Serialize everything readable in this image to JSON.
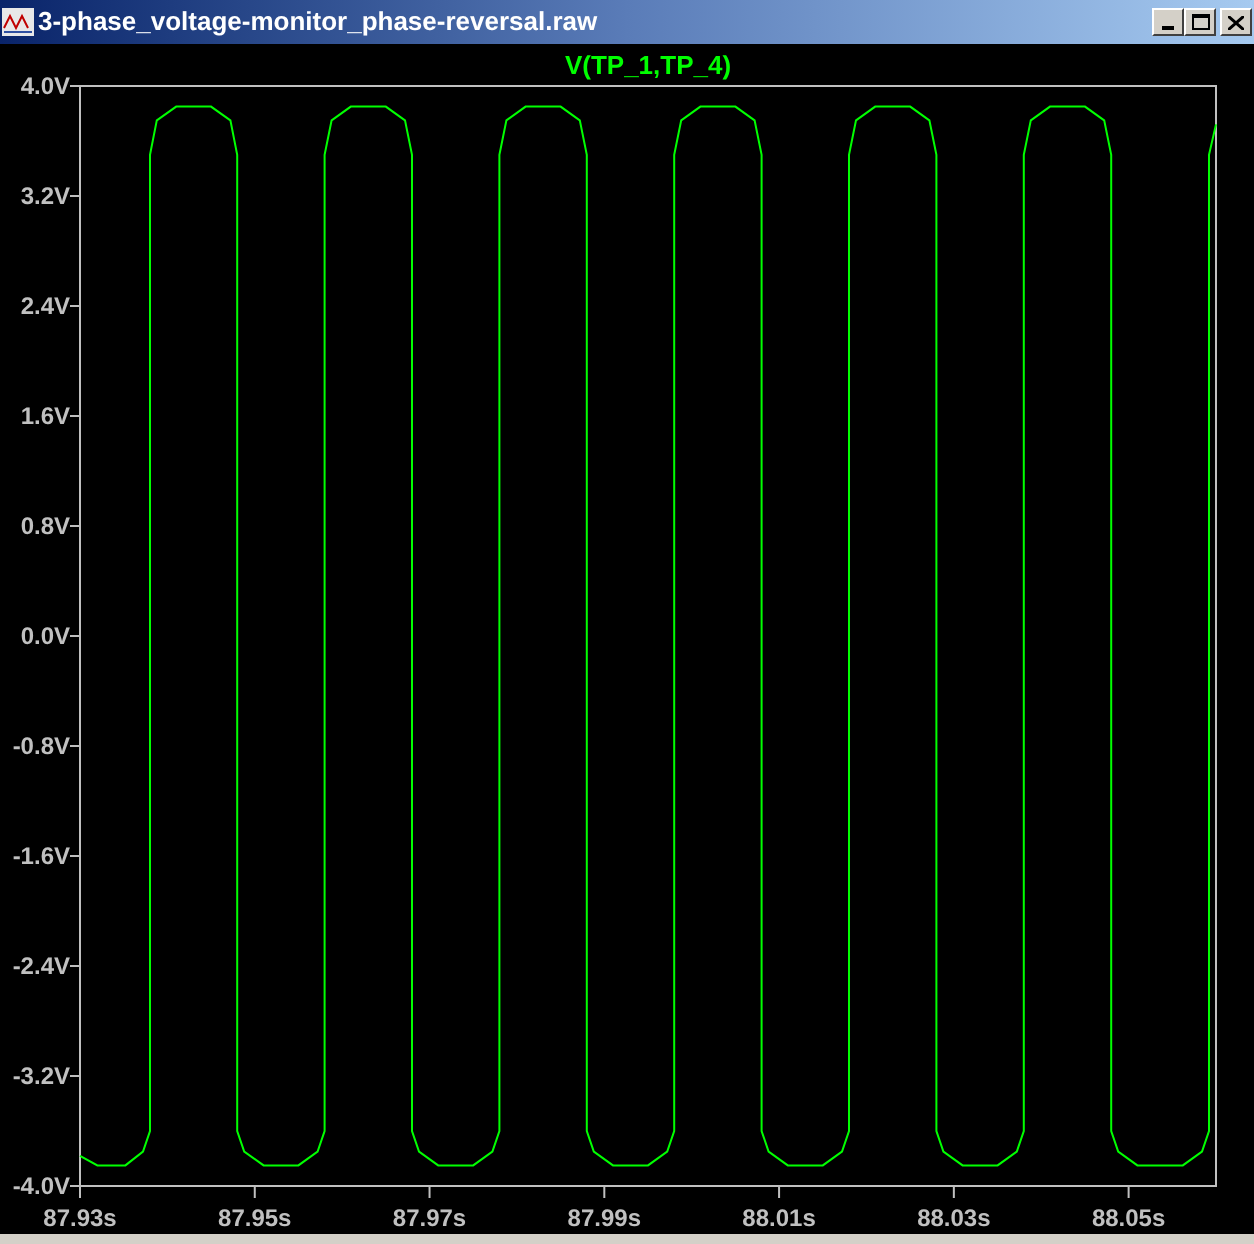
{
  "window": {
    "title": "3-phase_voltage-monitor_phase-reversal.raw"
  },
  "plot": {
    "chart_data": {
      "type": "line",
      "title": "V(TP_1,TP_4)",
      "xlim": [
        87.93,
        88.06
      ],
      "ylim": [
        -4,
        4
      ],
      "xticks": [
        {
          "value": 87.93,
          "label": "87.93s"
        },
        {
          "value": 87.95,
          "label": "87.95s"
        },
        {
          "value": 87.97,
          "label": "87.97s"
        },
        {
          "value": 87.99,
          "label": "87.99s"
        },
        {
          "value": 88.01,
          "label": "88.01s"
        },
        {
          "value": 88.03,
          "label": "88.03s"
        },
        {
          "value": 88.05,
          "label": "88.05s"
        }
      ],
      "yticks": [
        {
          "value": 4,
          "label": "4.0V"
        },
        {
          "value": 3.2,
          "label": "3.2V"
        },
        {
          "value": 2.4,
          "label": "2.4V"
        },
        {
          "value": 1.6,
          "label": "1.6V"
        },
        {
          "value": 0.8,
          "label": "0.8V"
        },
        {
          "value": 0,
          "label": "0.0V"
        },
        {
          "value": -0.8,
          "label": "-0.8V"
        },
        {
          "value": -1.6,
          "label": "-1.6V"
        },
        {
          "value": -2.4,
          "label": "-2.4V"
        },
        {
          "value": -3.2,
          "label": "-3.2V"
        },
        {
          "value": -4,
          "label": "-4.0V"
        }
      ],
      "x": [
        87.93,
        87.932,
        87.9352,
        87.9372,
        87.938,
        87.938,
        87.9388,
        87.941,
        87.945,
        87.9472,
        87.948,
        87.948,
        87.9488,
        87.951,
        87.955,
        87.9572,
        87.958,
        87.958,
        87.9588,
        87.961,
        87.965,
        87.9672,
        87.968,
        87.968,
        87.9688,
        87.971,
        87.975,
        87.9772,
        87.978,
        87.978,
        87.9788,
        87.981,
        87.985,
        87.9872,
        87.988,
        87.988,
        87.9888,
        87.991,
        87.995,
        87.9972,
        87.998,
        87.998,
        87.9988,
        88.001,
        88.005,
        88.0072,
        88.008,
        88.008,
        88.0088,
        88.011,
        88.015,
        88.0172,
        88.018,
        88.018,
        88.0188,
        88.021,
        88.025,
        88.0272,
        88.028,
        88.028,
        88.0288,
        88.031,
        88.035,
        88.0372,
        88.038,
        88.038,
        88.0388,
        88.041,
        88.045,
        88.0472,
        88.048,
        88.048,
        88.0488,
        88.051,
        88.0562,
        88.0584,
        88.0592,
        88.0592,
        88.06
      ],
      "series": [
        {
          "color": "#00ff00",
          "values": [
            -3.78,
            -3.85,
            -3.85,
            -3.75,
            -3.6,
            3.5,
            3.75,
            3.85,
            3.85,
            3.75,
            3.5,
            -3.6,
            -3.75,
            -3.85,
            -3.85,
            -3.75,
            -3.6,
            3.5,
            3.75,
            3.85,
            3.85,
            3.75,
            3.5,
            -3.6,
            -3.75,
            -3.85,
            -3.85,
            -3.75,
            -3.6,
            3.5,
            3.75,
            3.85,
            3.85,
            3.75,
            3.5,
            -3.6,
            -3.75,
            -3.85,
            -3.85,
            -3.75,
            -3.6,
            3.5,
            3.75,
            3.85,
            3.85,
            3.75,
            3.5,
            -3.6,
            -3.75,
            -3.85,
            -3.85,
            -3.75,
            -3.6,
            3.5,
            3.75,
            3.85,
            3.85,
            3.75,
            3.5,
            -3.6,
            -3.75,
            -3.85,
            -3.85,
            -3.75,
            -3.6,
            3.5,
            3.75,
            3.85,
            3.85,
            3.75,
            3.5,
            -3.6,
            -3.75,
            -3.85,
            -3.85,
            -3.75,
            -3.6,
            3.5,
            3.72
          ]
        }
      ]
    }
  }
}
